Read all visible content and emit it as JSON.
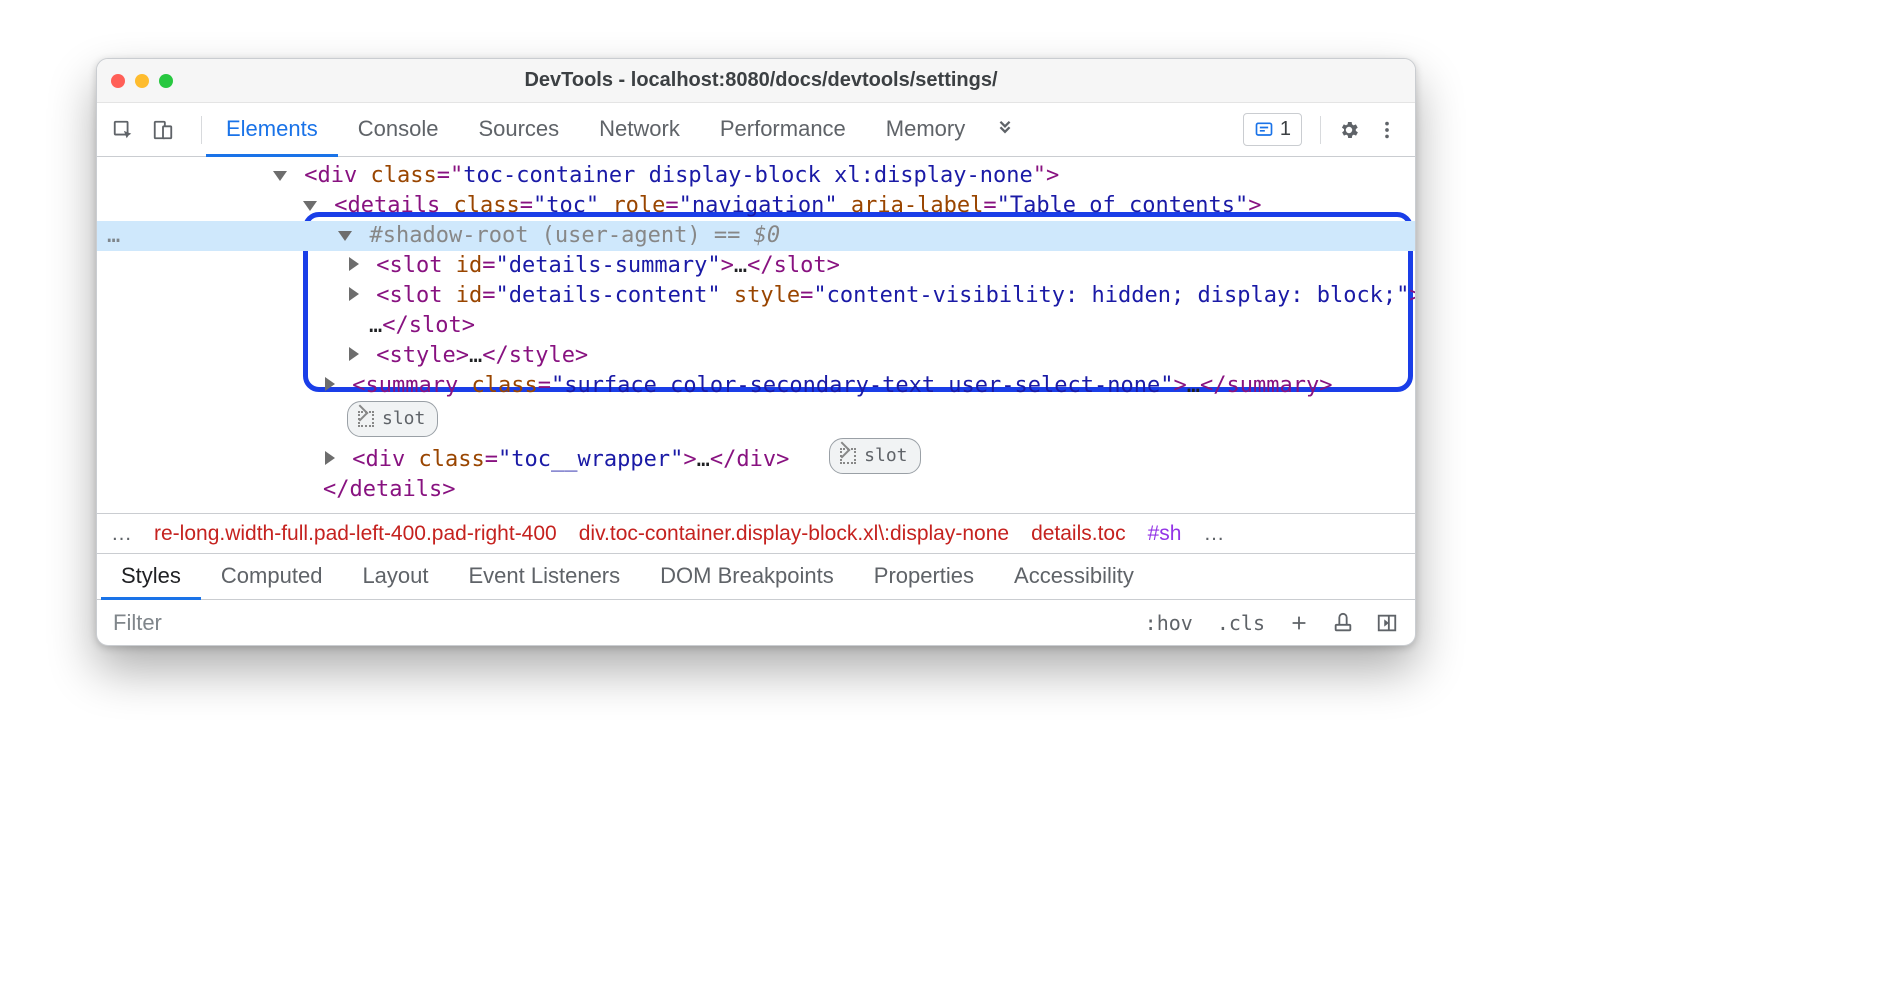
{
  "window": {
    "title": "DevTools - localhost:8080/docs/devtools/settings/"
  },
  "toolbar": {
    "tabs": [
      {
        "label": "Elements"
      },
      {
        "label": "Console"
      },
      {
        "label": "Sources"
      },
      {
        "label": "Network"
      },
      {
        "label": "Performance"
      },
      {
        "label": "Memory"
      }
    ],
    "issues_count": "1"
  },
  "dom": {
    "gutter_dots": "…",
    "line1": {
      "open": "<div ",
      "attr1n": "class",
      "attr1v": "\"toc-container display-block xl:display-none\"",
      "close": ">"
    },
    "line2": {
      "open": "<details ",
      "a1": "class",
      "v1": "\"toc\"",
      "a2": "role",
      "v2": "\"navigation\"",
      "a3": "aria-label",
      "v3": "\"Table of contents\"",
      "close": ">"
    },
    "line3": {
      "label": "#shadow-root (user-agent)",
      "eq": "== $0"
    },
    "line4": {
      "open": "<slot ",
      "a1": "id",
      "v1": "\"details-summary\"",
      "mid": ">",
      "ell": "…",
      "close": "</slot>"
    },
    "line5": {
      "open": "<slot ",
      "a1": "id",
      "v1": "\"details-content\"",
      "a2": "style",
      "v2": "\"content-visibility: hidden; display: block;\"",
      "mid": ">"
    },
    "line5b": {
      "ell": "…",
      "close": "</slot>"
    },
    "line6": {
      "open": "<style>",
      "ell": "…",
      "close": "</style>"
    },
    "line7": {
      "open": "<summary ",
      "a1": "class",
      "v1": "\"surface color-secondary-text user-select-none\"",
      "mid": ">",
      "ell": "…",
      "close": "</summary>"
    },
    "slot_badge": "slot",
    "line8": {
      "open": "<div ",
      "a1": "class",
      "v1": "\"toc__wrapper\"",
      "mid": ">",
      "ell": "…",
      "close": "</div>"
    },
    "line9": "</details>"
  },
  "breadcrumb": {
    "left_ell": "…",
    "items": [
      "re-long.width-full.pad-left-400.pad-right-400",
      "div.toc-container.display-block.xl\\:display-none",
      "details.toc",
      "#sh"
    ],
    "right_ell": "…"
  },
  "panel_tabs": [
    {
      "label": "Styles"
    },
    {
      "label": "Computed"
    },
    {
      "label": "Layout"
    },
    {
      "label": "Event Listeners"
    },
    {
      "label": "DOM Breakpoints"
    },
    {
      "label": "Properties"
    },
    {
      "label": "Accessibility"
    }
  ],
  "filter": {
    "placeholder": "Filter",
    "hov": ":hov",
    "cls": ".cls"
  }
}
